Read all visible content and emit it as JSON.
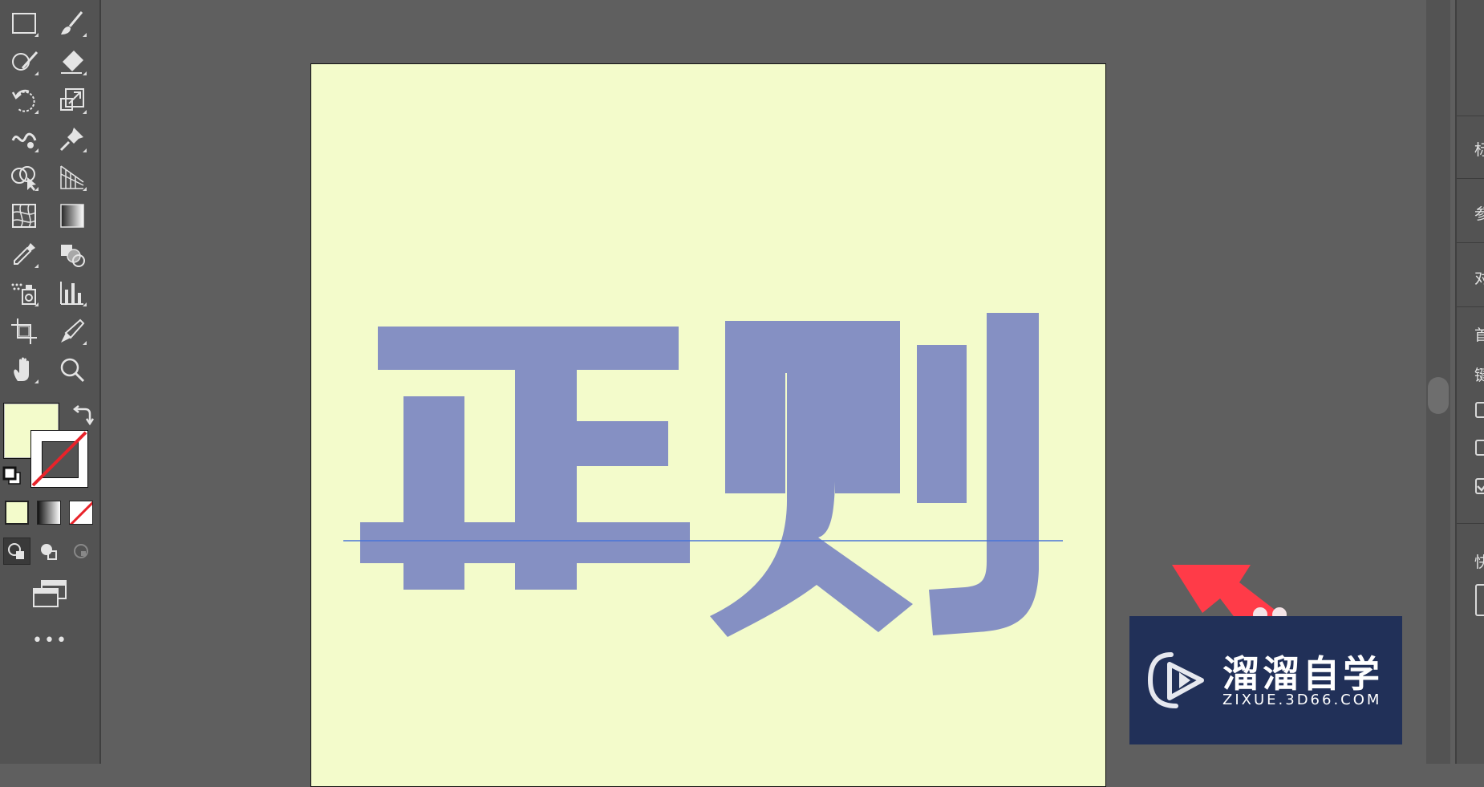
{
  "toolbar": {
    "tools": [
      {
        "name": "rectangle-tool-icon"
      },
      {
        "name": "paintbrush-tool-icon"
      },
      {
        "name": "shaper-tool-icon"
      },
      {
        "name": "eraser-tool-icon"
      },
      {
        "name": "rotate-tool-icon"
      },
      {
        "name": "scale-tool-icon"
      },
      {
        "name": "warp-tool-icon"
      },
      {
        "name": "pin-tool-icon"
      },
      {
        "name": "shape-builder-tool-icon"
      },
      {
        "name": "perspective-grid-tool-icon"
      },
      {
        "name": "mesh-tool-icon"
      },
      {
        "name": "gradient-tool-icon"
      },
      {
        "name": "eyedropper-tool-icon"
      },
      {
        "name": "blend-tool-icon"
      },
      {
        "name": "symbol-sprayer-tool-icon"
      },
      {
        "name": "column-graph-tool-icon"
      },
      {
        "name": "artboard-tool-icon"
      },
      {
        "name": "pen-tool-icon"
      },
      {
        "name": "hand-tool-icon"
      },
      {
        "name": "zoom-tool-icon"
      }
    ],
    "fill_color": "#f3fbcb",
    "stroke": "none",
    "more_label": "•••"
  },
  "canvas": {
    "artboard_color": "#f3fbcb",
    "artwork_text": "正则",
    "artwork_color": "#8590c3",
    "guide_color": "#4a74d8"
  },
  "annotation": {
    "arrow_color": "#ff3b48"
  },
  "right_panel": {
    "labels": [
      "标",
      "参",
      "对",
      "首",
      "键",
      "快"
    ],
    "checkboxes": [
      false,
      false,
      true
    ]
  },
  "watermark": {
    "brand": "溜溜自学",
    "url": "ZIXUE.3D66.COM",
    "bg_color": "#213058"
  }
}
